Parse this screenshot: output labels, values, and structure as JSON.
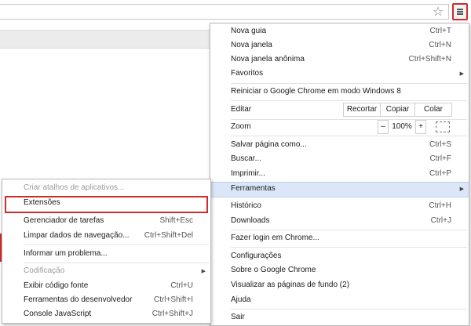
{
  "toolbar": {
    "star_glyph": "☆",
    "menu_button": "menu-icon"
  },
  "main_menu": {
    "nova_guia": {
      "label": "Nova guia",
      "shortcut": "Ctrl+T"
    },
    "nova_janela": {
      "label": "Nova janela",
      "shortcut": "Ctrl+N"
    },
    "nova_janela_anonima": {
      "label": "Nova janela anônima",
      "shortcut": "Ctrl+Shift+N"
    },
    "favoritos": {
      "label": "Favoritos"
    },
    "reiniciar": {
      "label": "Reiniciar o Google Chrome em modo Windows 8"
    },
    "editar": {
      "label": "Editar",
      "recortar": "Recortar",
      "copiar": "Copiar",
      "colar": "Colar"
    },
    "zoom": {
      "label": "Zoom",
      "minus": "–",
      "value": "100%",
      "plus": "+"
    },
    "salvar": {
      "label": "Salvar página como...",
      "shortcut": "Ctrl+S"
    },
    "buscar": {
      "label": "Buscar...",
      "shortcut": "Ctrl+F"
    },
    "imprimir": {
      "label": "Imprimir...",
      "shortcut": "Ctrl+P"
    },
    "ferramentas": {
      "label": "Ferramentas"
    },
    "historico": {
      "label": "Histórico",
      "shortcut": "Ctrl+H"
    },
    "downloads": {
      "label": "Downloads",
      "shortcut": "Ctrl+J"
    },
    "login": {
      "label": "Fazer login em Chrome..."
    },
    "configuracoes": {
      "label": "Configurações"
    },
    "sobre": {
      "label": "Sobre o Google Chrome"
    },
    "paginas_fundo": {
      "label": "Visualizar as páginas de fundo (2)"
    },
    "ajuda": {
      "label": "Ajuda"
    },
    "sair": {
      "label": "Sair"
    }
  },
  "sub_menu": {
    "criar_atalhos": {
      "label": "Criar atalhos de aplicativos..."
    },
    "extensoes": {
      "label": "Extensões"
    },
    "gerenciador": {
      "label": "Gerenciador de tarefas",
      "shortcut": "Shift+Esc"
    },
    "limpar": {
      "label": "Limpar dados de navegação...",
      "shortcut": "Ctrl+Shift+Del"
    },
    "informar": {
      "label": "Informar um problema..."
    },
    "codificacao": {
      "label": "Codificação"
    },
    "codigo_fonte": {
      "label": "Exibir código fonte",
      "shortcut": "Ctrl+U"
    },
    "dev_tools": {
      "label": "Ferramentas do desenvolvedor",
      "shortcut": "Ctrl+Shift+I"
    },
    "console": {
      "label": "Console JavaScript",
      "shortcut": "Ctrl+Shift+J"
    }
  },
  "colors": {
    "highlight_red": "#d42a2a",
    "active_blue": "#dbe7f8"
  }
}
